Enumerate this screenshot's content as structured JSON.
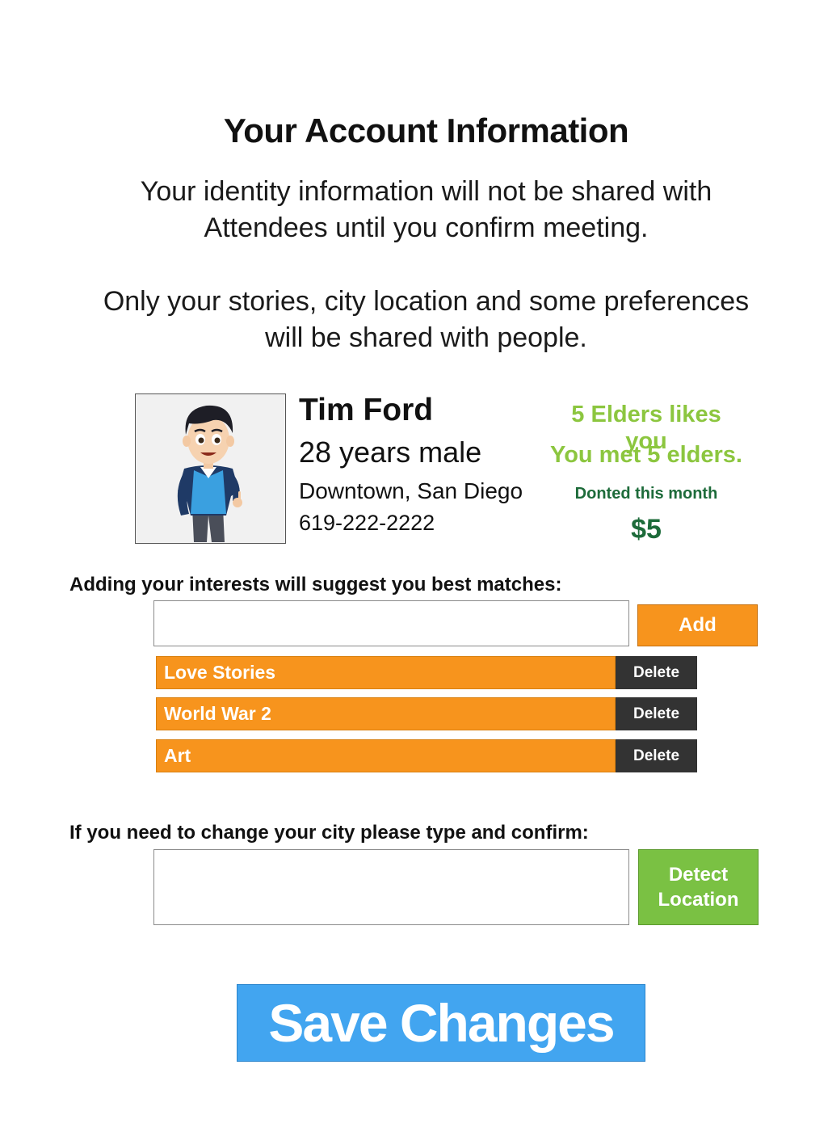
{
  "header": {
    "title": "Your Account Information",
    "intro_line1": "Your identity information will not be shared with",
    "intro_line2": "Attendees until you confirm meeting.",
    "intro_line3": "Only your stories, city location and some preferences",
    "intro_line4": "will be shared with people."
  },
  "profile": {
    "name": "Tim Ford",
    "age_gender": "28 years male",
    "location": "Downtown, San Diego",
    "phone": "619-222-2222",
    "avatar_icon": "cartoon-man-avatar"
  },
  "stats": {
    "likes": "5 Elders likes you",
    "met": "You met 5 elders.",
    "donated_label": "Donted this month",
    "donated_amount": "$5"
  },
  "interests": {
    "label": "Adding your interests will suggest you best matches:",
    "input_value": "",
    "add_label": "Add",
    "delete_label": "Delete",
    "items": [
      {
        "label": "Love Stories"
      },
      {
        "label": "World War 2"
      },
      {
        "label": "Art"
      }
    ]
  },
  "city": {
    "label": "If you need to change your city please type and confirm:",
    "input_value": "",
    "detect_label_line1": "Detect",
    "detect_label_line2": "Location"
  },
  "actions": {
    "save_label": "Save Changes"
  },
  "colors": {
    "orange": "#f7941d",
    "dark": "#333333",
    "light_green": "#8cc63f",
    "dark_green": "#1d6b3a",
    "button_green": "#7ac143",
    "blue": "#42a5f0"
  }
}
